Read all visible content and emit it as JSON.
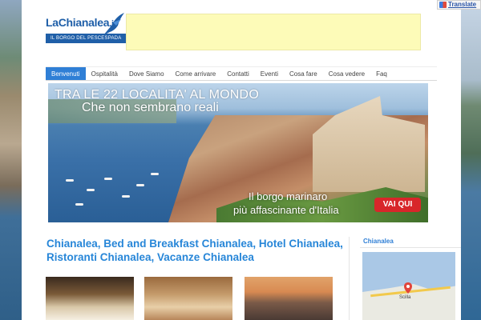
{
  "logo": {
    "name": "LaChianalea",
    "domain": ".it",
    "tagline": "IL BORGO DEL PESCESPADA"
  },
  "translate": {
    "label": "Translate"
  },
  "nav": {
    "items": [
      {
        "label": "Benvenuti",
        "active": true
      },
      {
        "label": "Ospitalità",
        "active": false
      },
      {
        "label": "Dove Siamo",
        "active": false
      },
      {
        "label": "Come arrivare",
        "active": false
      },
      {
        "label": "Contatti",
        "active": false
      },
      {
        "label": "Eventi",
        "active": false
      },
      {
        "label": "Cosa fare",
        "active": false
      },
      {
        "label": "Cosa vedere",
        "active": false
      },
      {
        "label": "Faq",
        "active": false
      }
    ]
  },
  "hero": {
    "title_line1": "TRA LE 22 LOCALITA' AL MONDO",
    "title_line2": "Che non sembrano reali",
    "subtitle_line1": "Il borgo marinaro",
    "subtitle_line2": "più affascinante d'Italia",
    "cta_label": "VAI QUI"
  },
  "main": {
    "headline": "Chianalea, Bed and Breakfast Chianalea, Hotel Chianalea, Ristoranti Chianalea, Vacanze Chianalea"
  },
  "sidebar": {
    "title": "Chianalea",
    "map_label": "Scilla"
  },
  "colors": {
    "accent": "#2f7fd6",
    "headline": "#2786d8",
    "cta": "#d8262a",
    "ad_banner": "#fdfbb8"
  }
}
